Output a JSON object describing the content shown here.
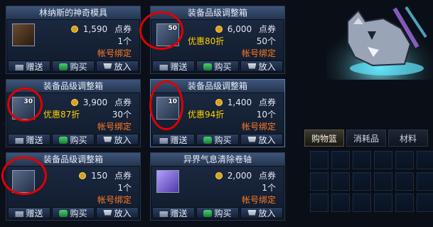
{
  "labels": {
    "gift": "赠送",
    "buy": "购买",
    "cart": "放入",
    "unit_price": "点券"
  },
  "items": [
    {
      "title": "林纳斯的神奇模具",
      "price": "1,590",
      "count": "1个",
      "discount": "",
      "bound": "帐号绑定",
      "icon": "mold-icon",
      "icon_num": ""
    },
    {
      "title": "装备品级调整箱",
      "price": "6,000",
      "count": "50个",
      "discount": "优惠80折",
      "bound": "帐号绑定",
      "icon": "equipment-box-icon",
      "icon_num": "50"
    },
    {
      "title": "装备品级调整箱",
      "price": "3,900",
      "count": "30个",
      "discount": "优惠87折",
      "bound": "帐号绑定",
      "icon": "equipment-box-icon",
      "icon_num": "30"
    },
    {
      "title": "装备品级调整箱",
      "price": "1,400",
      "count": "10个",
      "discount": "优惠94折",
      "bound": "帐号绑定",
      "icon": "equipment-box-icon",
      "icon_num": "10"
    },
    {
      "title": "装备品级调整箱",
      "price": "150",
      "count": "1个",
      "discount": "",
      "bound": "帐号绑定",
      "icon": "equipment-box-icon",
      "icon_num": ""
    },
    {
      "title": "异界气息清除卷轴",
      "price": "2,000",
      "count": "1个",
      "discount": "",
      "bound": "帐号绑定",
      "icon": "scroll-icon",
      "icon_num": ""
    }
  ],
  "right_panel": {
    "tabs": [
      "购物篮",
      "消耗品",
      "材料"
    ],
    "active_tab": "购物篮",
    "pet_icon": "wolf-pet-icon"
  },
  "colors": {
    "highlight_circle": "#e00000",
    "discount": "#ffd200",
    "bound": "#ff7a24"
  }
}
